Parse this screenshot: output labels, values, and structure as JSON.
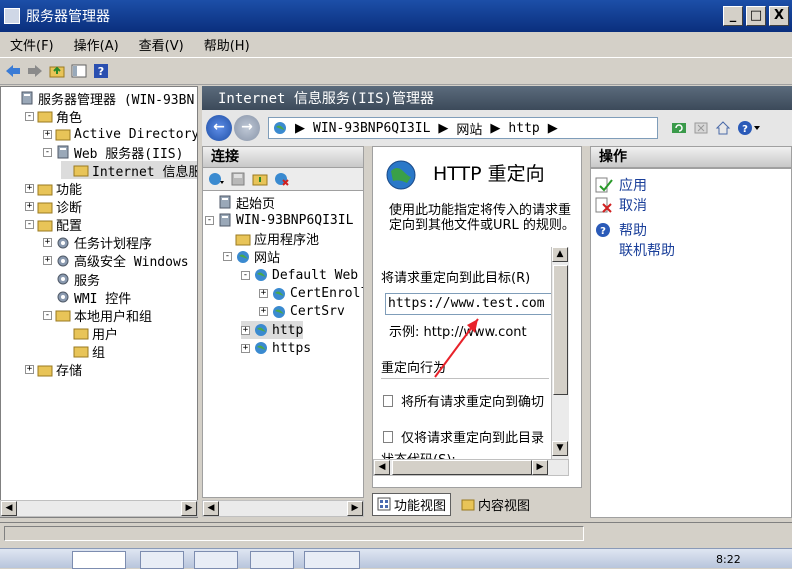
{
  "window": {
    "title": "服务器管理器",
    "minimize": "_",
    "maximize": "□",
    "close": "X"
  },
  "menu": [
    "文件(F)",
    "操作(A)",
    "查看(V)",
    "帮助(H)"
  ],
  "left_tree": [
    {
      "label": "服务器管理器 (WIN-93BN",
      "indent": 0,
      "exp": ""
    },
    {
      "label": "角色",
      "indent": 1,
      "exp": "-"
    },
    {
      "label": "Active Directory",
      "indent": 2,
      "exp": "+"
    },
    {
      "label": "Web 服务器(IIS)",
      "indent": 2,
      "exp": "-"
    },
    {
      "label": "Internet 信息服",
      "indent": 3,
      "exp": "",
      "selected": true
    },
    {
      "label": "功能",
      "indent": 1,
      "exp": "+"
    },
    {
      "label": "诊断",
      "indent": 1,
      "exp": "+"
    },
    {
      "label": "配置",
      "indent": 1,
      "exp": "-"
    },
    {
      "label": "任务计划程序",
      "indent": 2,
      "exp": "+"
    },
    {
      "label": "高级安全 Windows",
      "indent": 2,
      "exp": "+"
    },
    {
      "label": "服务",
      "indent": 2,
      "exp": ""
    },
    {
      "label": "WMI 控件",
      "indent": 2,
      "exp": ""
    },
    {
      "label": "本地用户和组",
      "indent": 2,
      "exp": "-"
    },
    {
      "label": "用户",
      "indent": 3,
      "exp": ""
    },
    {
      "label": "组",
      "indent": 3,
      "exp": ""
    },
    {
      "label": "存储",
      "indent": 1,
      "exp": "+"
    }
  ],
  "iis": {
    "header": "Internet 信息服务(IIS)管理器",
    "address": [
      "WIN-93BNP6QI3IL",
      "网站",
      "http"
    ]
  },
  "connections": {
    "title": "连接",
    "tree": [
      {
        "label": "起始页",
        "indent": 0,
        "exp": ""
      },
      {
        "label": "WIN-93BNP6QI3IL (",
        "indent": 0,
        "exp": "-"
      },
      {
        "label": "应用程序池",
        "indent": 1,
        "exp": ""
      },
      {
        "label": "网站",
        "indent": 1,
        "exp": "-"
      },
      {
        "label": "Default Web S",
        "indent": 2,
        "exp": "-"
      },
      {
        "label": "CertEnroll",
        "indent": 3,
        "exp": "+"
      },
      {
        "label": "CertSrv",
        "indent": 3,
        "exp": "+"
      },
      {
        "label": "http",
        "indent": 2,
        "exp": "+",
        "selected": true
      },
      {
        "label": "https",
        "indent": 2,
        "exp": "+"
      }
    ]
  },
  "feature": {
    "title": "HTTP 重定向",
    "description": "使用此功能指定将传入的请求重定向到其他文件或URL 的规则。",
    "redirect_label": "将请求重定向到此目标(R)",
    "url_value": "https://www.test.com",
    "example": "示例: http://www.cont",
    "behavior_label": "重定向行为",
    "option1": "将所有请求重定向到确切",
    "option2": "仅将请求重定向到此目录",
    "status_code": "状态代码(S):"
  },
  "views": {
    "features": "功能视图",
    "content": "内容视图"
  },
  "actions": {
    "title": "操作",
    "apply": "应用",
    "cancel": "取消",
    "help": "帮助",
    "online_help": "联机帮助"
  },
  "taskbar": {
    "clock": "8:22"
  },
  "colors": {
    "title_blue": "#0a2f7d",
    "link_blue": "#1a3f9a",
    "arrow_red": "#e8222a"
  }
}
